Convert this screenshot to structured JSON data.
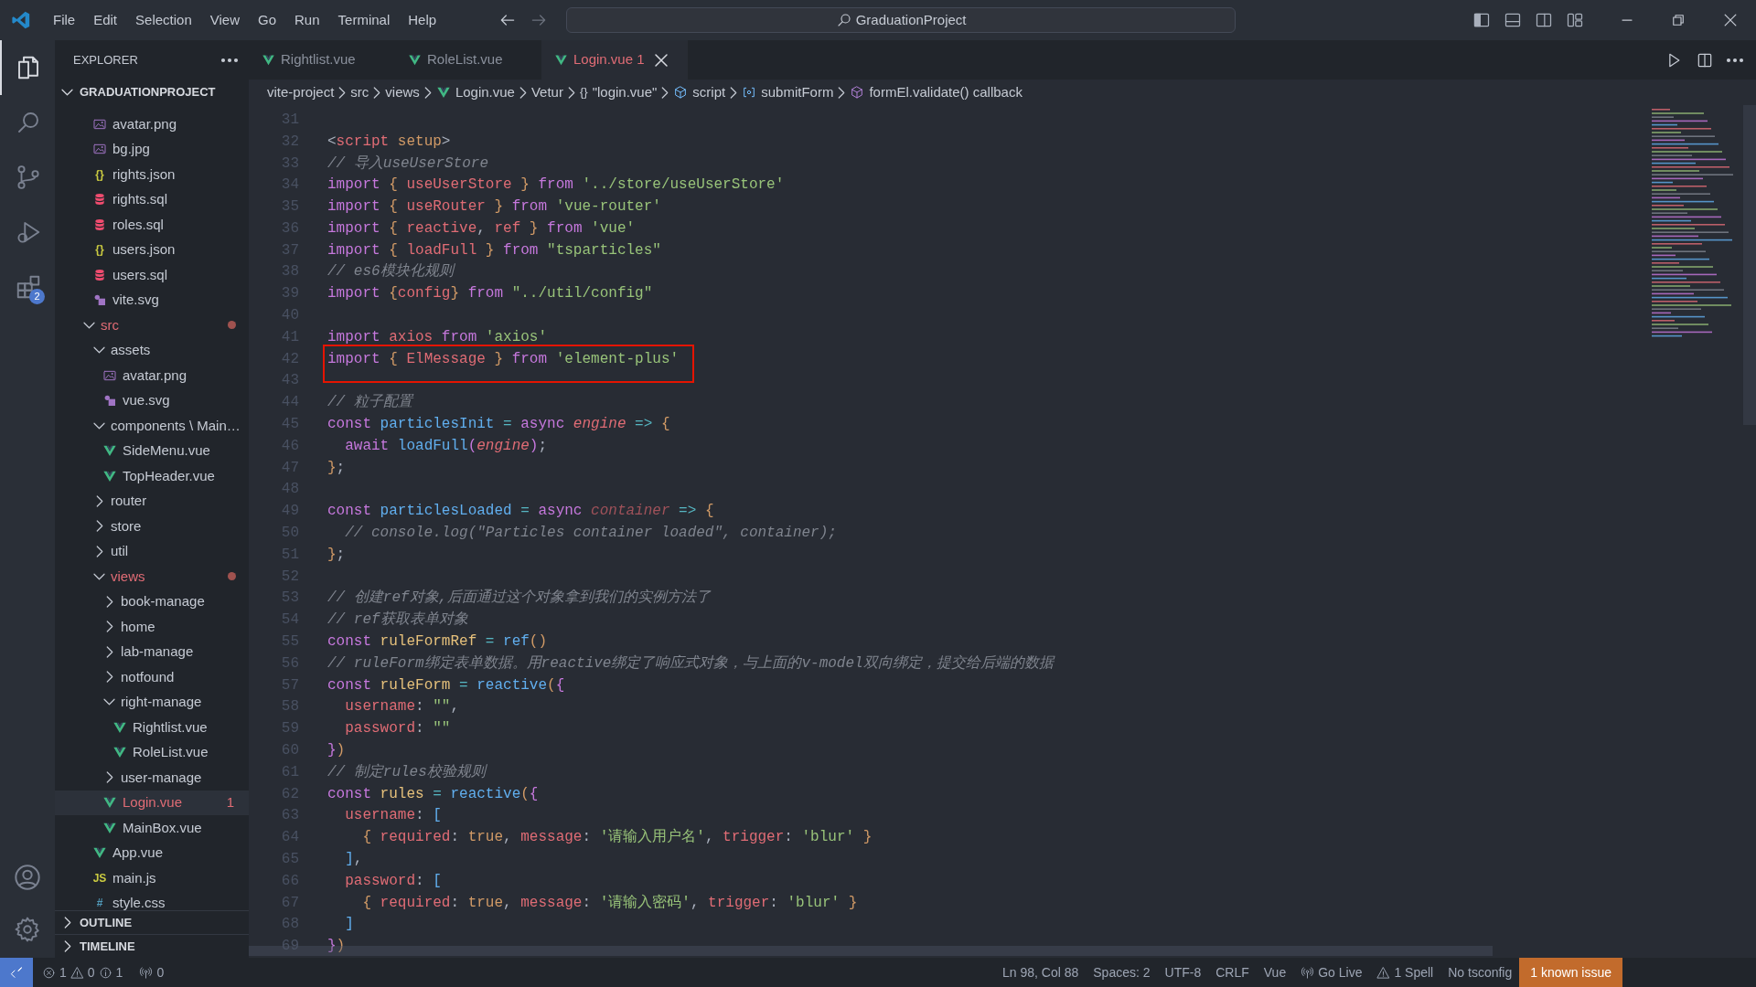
{
  "menu": [
    "File",
    "Edit",
    "Selection",
    "View",
    "Go",
    "Run",
    "Terminal",
    "Help"
  ],
  "command_center": {
    "text": "GraduationProject"
  },
  "activity_bar": {
    "items": [
      {
        "kind": "files",
        "selected": true
      },
      {
        "kind": "search",
        "selected": false
      },
      {
        "kind": "scm",
        "selected": false
      },
      {
        "kind": "debug",
        "selected": false
      },
      {
        "kind": "extensions",
        "selected": false,
        "badge": "2"
      }
    ]
  },
  "explorer": {
    "title": "EXPLORER",
    "root": "GRADUATIONPROJECT",
    "tree": [
      {
        "kind": "folder",
        "children": [
          {
            "kind": "image",
            "label": "avatar.png",
            "selected": false,
            "error": false
          },
          {
            "kind": "image",
            "label": "bg.jpg",
            "selected": false,
            "error": false
          },
          {
            "kind": "json",
            "icon_text": "{}",
            "label": "rights.json",
            "selected": false,
            "error": false
          },
          {
            "kind": "database",
            "label": "rights.sql",
            "selected": false,
            "error": false
          },
          {
            "kind": "database",
            "label": "roles.sql",
            "selected": false,
            "error": false
          },
          {
            "kind": "json",
            "icon_text": "{}",
            "label": "users.json",
            "selected": false,
            "error": false
          },
          {
            "kind": "database",
            "label": "users.sql",
            "selected": false,
            "error": false
          },
          {
            "kind": "svg",
            "label": "vite.svg",
            "selected": false,
            "error": false
          }
        ]
      },
      {
        "kind": "folder",
        "label": "src",
        "expanded": true,
        "selected": false,
        "error": true,
        "children": [
          {
            "kind": "folder",
            "label": "assets",
            "expanded": true,
            "selected": false,
            "error": false,
            "children": [
              {
                "kind": "image",
                "label": "avatar.png",
                "selected": false,
                "error": false
              },
              {
                "kind": "svg",
                "label": "vue.svg",
                "selected": false,
                "error": false
              }
            ]
          },
          {
            "kind": "folder",
            "label": "components \\ Main…",
            "expanded": true,
            "selected": false,
            "error": false,
            "children": [
              {
                "kind": "vue",
                "label": "SideMenu.vue",
                "selected": false,
                "error": false
              },
              {
                "kind": "vue",
                "label": "TopHeader.vue",
                "selected": false,
                "error": false
              }
            ]
          },
          {
            "kind": "folder",
            "label": "router",
            "expanded": false,
            "selected": false,
            "error": false
          },
          {
            "kind": "folder",
            "label": "store",
            "expanded": false,
            "selected": false,
            "error": false
          },
          {
            "kind": "folder",
            "label": "util",
            "expanded": false,
            "selected": false,
            "error": false
          },
          {
            "kind": "folder",
            "label": "views",
            "expanded": true,
            "selected": false,
            "error": true,
            "children": [
              {
                "kind": "folder",
                "label": "book-manage",
                "expanded": false,
                "selected": false,
                "error": false
              },
              {
                "kind": "folder",
                "label": "home",
                "expanded": false,
                "selected": false,
                "error": false
              },
              {
                "kind": "folder",
                "label": "lab-manage",
                "expanded": false,
                "selected": false,
                "error": false
              },
              {
                "kind": "folder",
                "label": "notfound",
                "expanded": false,
                "selected": false,
                "error": false
              },
              {
                "kind": "folder",
                "label": "right-manage",
                "expanded": true,
                "selected": false,
                "error": false,
                "children": [
                  {
                    "kind": "vue",
                    "label": "Rightlist.vue",
                    "selected": false,
                    "error": false
                  },
                  {
                    "kind": "vue",
                    "label": "RoleList.vue",
                    "selected": false,
                    "error": false
                  }
                ]
              },
              {
                "kind": "folder",
                "label": "user-manage",
                "expanded": false,
                "selected": false,
                "error": false
              },
              {
                "kind": "vue",
                "label": "Login.vue",
                "selected": true,
                "error": true,
                "problems": "1"
              },
              {
                "kind": "vue",
                "label": "MainBox.vue",
                "selected": false,
                "error": false
              }
            ]
          },
          {
            "kind": "vue",
            "label": "App.vue",
            "selected": false,
            "error": false
          },
          {
            "kind": "js",
            "icon_text": "JS",
            "label": "main.js",
            "selected": false,
            "error": false
          },
          {
            "kind": "css",
            "icon_text": "#",
            "label": "style.css",
            "selected": false,
            "error": false
          }
        ]
      }
    ],
    "sections": [
      {
        "label": "OUTLINE",
        "expanded": false
      },
      {
        "label": "TIMELINE",
        "expanded": false
      }
    ]
  },
  "tabs": [
    {
      "label": "Rightlist.vue",
      "selected": false,
      "error": false
    },
    {
      "label": "RoleList.vue",
      "selected": false,
      "error": false
    },
    {
      "label": "Login.vue",
      "problems": "1",
      "selected": true,
      "error": true
    }
  ],
  "breadcrumbs": [
    {
      "label": "vite-project"
    },
    {
      "label": "src"
    },
    {
      "label": "views"
    },
    {
      "label": "Login.vue",
      "kind": "vue"
    },
    {
      "label": "Vetur"
    },
    {
      "label": "\"login.vue\"",
      "icon_text": "{}"
    },
    {
      "label": "script",
      "kind": "module"
    },
    {
      "label": "submitForm",
      "kind": "variable"
    },
    {
      "label": "formEl.validate() callback",
      "kind": "method"
    }
  ],
  "code": {
    "lines": [
      {
        "n": "31"
      },
      {
        "n": "32",
        "tokens": [
          {
            "kind": "plain",
            "text": "<"
          },
          {
            "kind": "tag",
            "text": "script"
          },
          {
            "kind": "number",
            "text": " setup"
          },
          {
            "kind": "plain",
            "text": ">"
          }
        ]
      },
      {
        "n": "33",
        "tokens": [
          {
            "kind": "comment",
            "text": "// 导入useUserStore"
          }
        ]
      },
      {
        "n": "34",
        "tokens": [
          {
            "kind": "keyword",
            "text": "import "
          },
          {
            "kind": "brace",
            "text": "{"
          },
          {
            "kind": "variable",
            "text": " useUserStore "
          },
          {
            "kind": "brace",
            "text": "}"
          },
          {
            "kind": "keyword",
            "text": " from "
          },
          {
            "kind": "string",
            "text": "'../store/useUserStore'"
          }
        ]
      },
      {
        "n": "35",
        "tokens": [
          {
            "kind": "keyword",
            "text": "import "
          },
          {
            "kind": "brace",
            "text": "{"
          },
          {
            "kind": "variable",
            "text": " useRouter "
          },
          {
            "kind": "brace",
            "text": "}"
          },
          {
            "kind": "keyword",
            "text": " from "
          },
          {
            "kind": "string",
            "text": "'vue-router'"
          }
        ]
      },
      {
        "n": "36",
        "tokens": [
          {
            "kind": "keyword",
            "text": "import "
          },
          {
            "kind": "brace",
            "text": "{"
          },
          {
            "kind": "variable",
            "text": " reactive"
          },
          {
            "kind": "plain",
            "text": ", "
          },
          {
            "kind": "variable",
            "text": "ref "
          },
          {
            "kind": "brace",
            "text": "}"
          },
          {
            "kind": "keyword",
            "text": " from "
          },
          {
            "kind": "string",
            "text": "'vue'"
          }
        ]
      },
      {
        "n": "37",
        "tokens": [
          {
            "kind": "keyword",
            "text": "import "
          },
          {
            "kind": "brace",
            "text": "{"
          },
          {
            "kind": "variable",
            "text": " loadFull "
          },
          {
            "kind": "brace",
            "text": "}"
          },
          {
            "kind": "keyword",
            "text": " from "
          },
          {
            "kind": "string",
            "text": "\"tsparticles\""
          }
        ]
      },
      {
        "n": "38",
        "tokens": [
          {
            "kind": "comment",
            "text": "// es6模块化规则"
          }
        ]
      },
      {
        "n": "39",
        "tokens": [
          {
            "kind": "keyword",
            "text": "import "
          },
          {
            "kind": "brace",
            "text": "{"
          },
          {
            "kind": "variable",
            "text": "config"
          },
          {
            "kind": "brace",
            "text": "}"
          },
          {
            "kind": "keyword",
            "text": " from "
          },
          {
            "kind": "string",
            "text": "\"../util/config\""
          }
        ]
      },
      {
        "n": "40"
      },
      {
        "n": "41",
        "tokens": [
          {
            "kind": "keyword",
            "text": "import"
          },
          {
            "kind": "variable",
            "text": " axios"
          },
          {
            "kind": "keyword",
            "text": " from "
          },
          {
            "kind": "string",
            "text": "'axios'"
          }
        ]
      },
      {
        "n": "42",
        "boxed": true,
        "tokens": [
          {
            "kind": "keyword",
            "text": "import "
          },
          {
            "kind": "brace",
            "text": "{"
          },
          {
            "kind": "variable",
            "text": " ElMessage "
          },
          {
            "kind": "brace",
            "text": "}"
          },
          {
            "kind": "keyword",
            "text": " from "
          },
          {
            "kind": "string",
            "text": "'element-plus'"
          }
        ]
      },
      {
        "n": "43"
      },
      {
        "n": "44",
        "tokens": [
          {
            "kind": "comment",
            "text": "// 粒子配置"
          }
        ]
      },
      {
        "n": "45",
        "tokens": [
          {
            "kind": "keyword",
            "text": "const"
          },
          {
            "kind": "function",
            "text": " particlesInit"
          },
          {
            "kind": "operator",
            "text": " = "
          },
          {
            "kind": "keyword",
            "text": "async"
          },
          {
            "kind": "param",
            "text": " engine"
          },
          {
            "kind": "operator",
            "text": " =>"
          },
          {
            "kind": "brace",
            "text": " {"
          }
        ]
      },
      {
        "n": "46",
        "tokens": [
          {
            "kind": "keyword",
            "text": "  await"
          },
          {
            "kind": "function",
            "text": " loadFull"
          },
          {
            "kind": "paren",
            "text": "("
          },
          {
            "kind": "param",
            "text": "engine"
          },
          {
            "kind": "paren",
            "text": ")"
          },
          {
            "kind": "plain",
            "text": ";"
          }
        ]
      },
      {
        "n": "47",
        "tokens": [
          {
            "kind": "brace",
            "text": "}"
          },
          {
            "kind": "plain",
            "text": ";"
          }
        ]
      },
      {
        "n": "48"
      },
      {
        "n": "49",
        "tokens": [
          {
            "kind": "keyword",
            "text": "const"
          },
          {
            "kind": "function",
            "text": " particlesLoaded"
          },
          {
            "kind": "operator",
            "text": " = "
          },
          {
            "kind": "keyword",
            "text": "async"
          },
          {
            "kind": "unused",
            "text": " container"
          },
          {
            "kind": "operator",
            "text": " =>"
          },
          {
            "kind": "brace",
            "text": " {"
          }
        ]
      },
      {
        "n": "50",
        "tokens": [
          {
            "kind": "comment",
            "text": "  // console.log(\"Particles container loaded\", container);"
          }
        ]
      },
      {
        "n": "51",
        "tokens": [
          {
            "kind": "brace",
            "text": "}"
          },
          {
            "kind": "plain",
            "text": ";"
          }
        ]
      },
      {
        "n": "52"
      },
      {
        "n": "53",
        "tokens": [
          {
            "kind": "comment",
            "text": "// 创建ref对象,后面通过这个对象拿到我们的实例方法了"
          }
        ]
      },
      {
        "n": "54",
        "tokens": [
          {
            "kind": "comment",
            "text": "// ref获取表单对象"
          }
        ]
      },
      {
        "n": "55",
        "tokens": [
          {
            "kind": "keyword",
            "text": "const"
          },
          {
            "kind": "constant",
            "text": " ruleFormRef"
          },
          {
            "kind": "operator",
            "text": " = "
          },
          {
            "kind": "function",
            "text": "ref"
          },
          {
            "kind": "brace",
            "text": "()"
          }
        ]
      },
      {
        "n": "56",
        "tokens": [
          {
            "kind": "comment",
            "text": "// ruleForm绑定表单数据。用reactive绑定了响应式对象，与上面的v-model双向绑定，提交给后端的数据"
          }
        ]
      },
      {
        "n": "57",
        "tokens": [
          {
            "kind": "keyword",
            "text": "const"
          },
          {
            "kind": "constant",
            "text": " ruleForm"
          },
          {
            "kind": "operator",
            "text": " = "
          },
          {
            "kind": "function",
            "text": "reactive"
          },
          {
            "kind": "brace",
            "text": "("
          },
          {
            "kind": "paren",
            "text": "{"
          }
        ]
      },
      {
        "n": "58",
        "tokens": [
          {
            "kind": "variable",
            "text": "  username"
          },
          {
            "kind": "plain",
            "text": ": "
          },
          {
            "kind": "string",
            "text": "\"\""
          },
          {
            "kind": "plain",
            "text": ","
          }
        ]
      },
      {
        "n": "59",
        "tokens": [
          {
            "kind": "variable",
            "text": "  password"
          },
          {
            "kind": "plain",
            "text": ": "
          },
          {
            "kind": "string",
            "text": "\"\""
          }
        ]
      },
      {
        "n": "60",
        "tokens": [
          {
            "kind": "paren",
            "text": "}"
          },
          {
            "kind": "brace",
            "text": ")"
          }
        ]
      },
      {
        "n": "61",
        "tokens": [
          {
            "kind": "comment",
            "text": "// 制定rules校验规则"
          }
        ]
      },
      {
        "n": "62",
        "tokens": [
          {
            "kind": "keyword",
            "text": "const"
          },
          {
            "kind": "constant",
            "text": " rules"
          },
          {
            "kind": "operator",
            "text": " = "
          },
          {
            "kind": "function",
            "text": "reactive"
          },
          {
            "kind": "brace",
            "text": "("
          },
          {
            "kind": "paren",
            "text": "{"
          }
        ]
      },
      {
        "n": "63",
        "tokens": [
          {
            "kind": "variable",
            "text": "  username"
          },
          {
            "kind": "plain",
            "text": ": "
          },
          {
            "kind": "bracket",
            "text": "["
          }
        ]
      },
      {
        "n": "64",
        "tokens": [
          {
            "kind": "brace",
            "text": "    {"
          },
          {
            "kind": "variable",
            "text": " required"
          },
          {
            "kind": "plain",
            "text": ": "
          },
          {
            "kind": "number",
            "text": "true"
          },
          {
            "kind": "plain",
            "text": ", "
          },
          {
            "kind": "variable",
            "text": "message"
          },
          {
            "kind": "plain",
            "text": ": "
          },
          {
            "kind": "string",
            "text": "'请输入用户名'"
          },
          {
            "kind": "plain",
            "text": ", "
          },
          {
            "kind": "variable",
            "text": "trigger"
          },
          {
            "kind": "plain",
            "text": ": "
          },
          {
            "kind": "string",
            "text": "'blur'"
          },
          {
            "kind": "brace",
            "text": " }"
          }
        ]
      },
      {
        "n": "65",
        "tokens": [
          {
            "kind": "bracket",
            "text": "  ]"
          },
          {
            "kind": "plain",
            "text": ","
          }
        ]
      },
      {
        "n": "66",
        "tokens": [
          {
            "kind": "variable",
            "text": "  password"
          },
          {
            "kind": "plain",
            "text": ": "
          },
          {
            "kind": "bracket",
            "text": "["
          }
        ]
      },
      {
        "n": "67",
        "tokens": [
          {
            "kind": "brace",
            "text": "    {"
          },
          {
            "kind": "variable",
            "text": " required"
          },
          {
            "kind": "plain",
            "text": ": "
          },
          {
            "kind": "number",
            "text": "true"
          },
          {
            "kind": "plain",
            "text": ", "
          },
          {
            "kind": "variable",
            "text": "message"
          },
          {
            "kind": "plain",
            "text": ": "
          },
          {
            "kind": "string",
            "text": "'请输入密码'"
          },
          {
            "kind": "plain",
            "text": ", "
          },
          {
            "kind": "variable",
            "text": "trigger"
          },
          {
            "kind": "plain",
            "text": ": "
          },
          {
            "kind": "string",
            "text": "'blur'"
          },
          {
            "kind": "brace",
            "text": " }"
          }
        ]
      },
      {
        "n": "68",
        "tokens": [
          {
            "kind": "bracket",
            "text": "  ]"
          }
        ]
      },
      {
        "n": "69",
        "tokens": [
          {
            "kind": "paren",
            "text": "}"
          },
          {
            "kind": "brace",
            "text": ")"
          }
        ]
      }
    ]
  },
  "status_bar": {
    "left": [
      {
        "kind": "error",
        "text": "1"
      },
      {
        "kind": "warning",
        "text": "0"
      },
      {
        "kind": "info",
        "text": "1"
      },
      {
        "kind": "ports",
        "text": "0"
      }
    ],
    "right": [
      {
        "text": "Ln 98, Col 88",
        "highlighted": false
      },
      {
        "text": "Spaces: 2",
        "highlighted": false
      },
      {
        "text": "UTF-8",
        "highlighted": false
      },
      {
        "text": "CRLF",
        "highlighted": false
      },
      {
        "text": "Vue",
        "highlighted": false
      },
      {
        "kind": "ports",
        "text": "Go Live",
        "highlighted": false
      },
      {
        "kind": "warning",
        "text": "1 Spell",
        "highlighted": false
      },
      {
        "text": "No tsconfig",
        "highlighted": false
      },
      {
        "text": "1 known issue",
        "highlighted": true
      }
    ]
  }
}
